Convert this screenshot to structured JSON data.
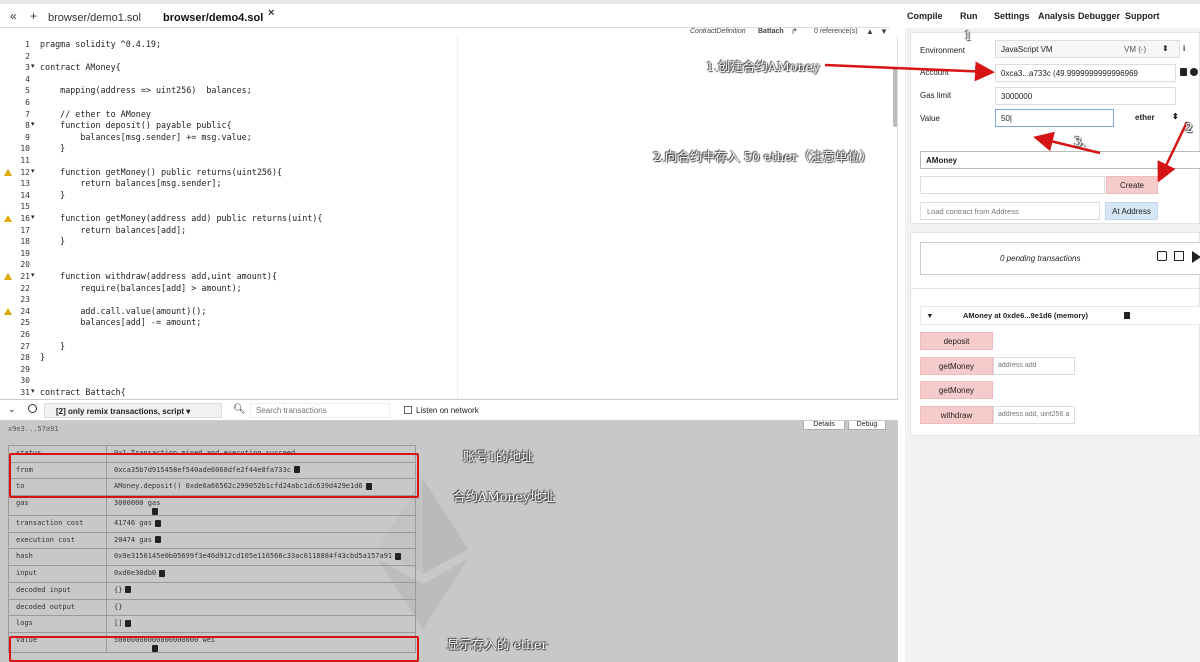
{
  "tabs": {
    "collapse": "«",
    "add": "+",
    "files": [
      "browser/demo1.sol",
      "browser/demo4.sol"
    ],
    "close": "×",
    "expand": "»"
  },
  "right_tabs": [
    "Compile",
    "Run",
    "Settings",
    "Analysis",
    "Debugger",
    "Support"
  ],
  "context_bar": {
    "def_label": "ContractDefinition",
    "def_name": "Battach",
    "refs": "0 reference(s)"
  },
  "editor": {
    "line_numbers": [
      "1",
      "2",
      "3",
      "4",
      "5",
      "6",
      "7",
      "8",
      "9",
      "10",
      "11",
      "12",
      "13",
      "14",
      "15",
      "16",
      "17",
      "18",
      "19",
      "20",
      "21",
      "22",
      "23",
      "24",
      "25",
      "26",
      "27",
      "28",
      "29",
      "30",
      "31"
    ],
    "fold_lines": [
      "3",
      "8",
      "12",
      "16",
      "21",
      "31"
    ],
    "warning_lines": [
      "12",
      "16",
      "21",
      "24"
    ],
    "code": [
      "pragma solidity ^0.4.19;",
      "",
      "contract AMoney{",
      "",
      "    mapping(address => uint256)  balances;",
      "",
      "    // ether to AMoney",
      "    function deposit() payable public{",
      "        balances[msg.sender] += msg.value;",
      "    }",
      "",
      "    function getMoney() public returns(uint256){",
      "        return balances[msg.sender];",
      "    }",
      "",
      "    function getMoney(address add) public returns(uint){",
      "        return balances[add];",
      "    }",
      "",
      "",
      "    function withdraw(address add,uint amount){",
      "        require(balances[add] > amount);",
      "",
      "        add.call.value(amount)();",
      "        balances[add] -= amount;",
      "",
      "    }",
      "}",
      "",
      "",
      "contract Battach{"
    ]
  },
  "terminal": {
    "filter_label": "[2] only remix transactions, script",
    "search_placeholder": "Search transactions",
    "listen_label": "Listen on network",
    "tx_header": "x9e3...57a91",
    "details_btn": "Details",
    "debug_btn": "Debug",
    "rows": [
      {
        "key": "status",
        "value": "0x1 Transaction mined and execution succeed"
      },
      {
        "key": "from",
        "value": "0xca35b7d915458ef540ade6068dfe2f44e8fa733c"
      },
      {
        "key": "to",
        "value": "AMoney.deposit() 0xde6a66562c299052b1cfd24abc1dc639d429e1d6"
      },
      {
        "key": "gas",
        "value": "3000000 gas"
      },
      {
        "key": "transaction cost",
        "value": "41746 gas"
      },
      {
        "key": "execution cost",
        "value": "20474 gas"
      },
      {
        "key": "hash",
        "value": "0x9e3150145e0b05699f3e46d912cd105e116566c33ac0118884f43cbd5a157a91"
      },
      {
        "key": "input",
        "value": "0xd0e30db0"
      },
      {
        "key": "decoded input",
        "value": "{}"
      },
      {
        "key": "decoded output",
        "value": "{}"
      },
      {
        "key": "logs",
        "value": "[]"
      },
      {
        "key": "value",
        "value": "50000000000000000000 wei"
      }
    ]
  },
  "run": {
    "environment_label": "Environment",
    "environment_value": "JavaScript VM",
    "vm_label": "VM (-)",
    "account_label": "Account",
    "account_value": "0xca3...a733c (49.9999999999996969",
    "gaslimit_label": "Gas limit",
    "gaslimit_value": "3000000",
    "value_label": "Value",
    "value_value": "50",
    "unit_value": "ether",
    "contract_select": "AMoney",
    "create_label": "Create",
    "load_placeholder": "Load contract from Address",
    "at_address_label": "At Address",
    "pending": "0 pending transactions",
    "instance_title": "AMoney at 0xde6...9e1d6 (memory)",
    "functions": [
      {
        "label": "deposit",
        "placeholder": ""
      },
      {
        "label": "getMoney",
        "placeholder": "address add"
      },
      {
        "label": "getMoney",
        "placeholder": ""
      },
      {
        "label": "withdraw",
        "placeholder": "address add, uint256 a"
      }
    ]
  },
  "annotations": {
    "n1": "1",
    "n2": "2",
    "n3": "3.",
    "step1": "1.创建合约AMoney",
    "step2": "2.向合约中存入 50 ether（注意单位）",
    "from_note": "账号1的地址",
    "to_note": "合约AMoney地址",
    "value_note": "显示存入的 ether"
  },
  "colors": {
    "annotation_red": "#d61414",
    "function_button": "#f6cbcb",
    "at_address_button": "#d7e6f7",
    "terminal_bg": "#c8c8c8"
  }
}
